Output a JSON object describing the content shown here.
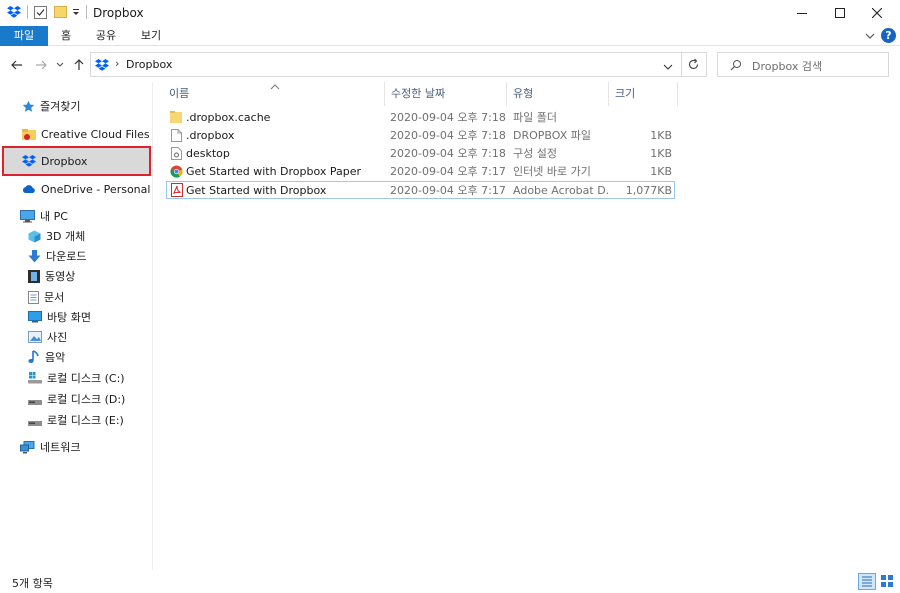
{
  "window": {
    "title": "Dropbox"
  },
  "ribbon": {
    "tabs": [
      "파일",
      "홈",
      "공유",
      "보기"
    ]
  },
  "address": {
    "segment": "Dropbox"
  },
  "search": {
    "placeholder": "Dropbox 검색"
  },
  "nav": {
    "quick_access": "즐겨찾기",
    "creative_cloud": "Creative Cloud Files",
    "dropbox": "Dropbox",
    "onedrive": "OneDrive - Personal",
    "this_pc": "내 PC",
    "pc_items": [
      "3D 개체",
      "다운로드",
      "동영상",
      "문서",
      "바탕 화면",
      "사진",
      "음악",
      "로컬 디스크 (C:)",
      "로컬 디스크 (D:)",
      "로컬 디스크 (E:)"
    ],
    "network": "네트워크"
  },
  "columns": {
    "name": "이름",
    "date": "수정한 날짜",
    "type": "유형",
    "size": "크기"
  },
  "files": [
    {
      "name": ".dropbox.cache",
      "date": "2020-09-04 오후 7:18",
      "type": "파일 폴더",
      "size": "",
      "icon": "folder-icon"
    },
    {
      "name": ".dropbox",
      "date": "2020-09-04 오후 7:18",
      "type": "DROPBOX 파일",
      "size": "1KB",
      "icon": "file-icon"
    },
    {
      "name": "desktop",
      "date": "2020-09-04 오후 7:18",
      "type": "구성 설정",
      "size": "1KB",
      "icon": "settings-file-icon"
    },
    {
      "name": "Get Started with Dropbox Paper",
      "date": "2020-09-04 오후 7:17",
      "type": "인터넷 바로 가기",
      "size": "1KB",
      "icon": "chrome-icon"
    },
    {
      "name": "Get Started with Dropbox",
      "date": "2020-09-04 오후 7:17",
      "type": "Adobe Acrobat D...",
      "size": "1,077KB",
      "icon": "pdf-icon"
    }
  ],
  "status": {
    "count": "5개 항목"
  },
  "colors": {
    "accent": "#1979ca",
    "dropbox_blue": "#0061fe",
    "selection_border": "#d9232e"
  }
}
